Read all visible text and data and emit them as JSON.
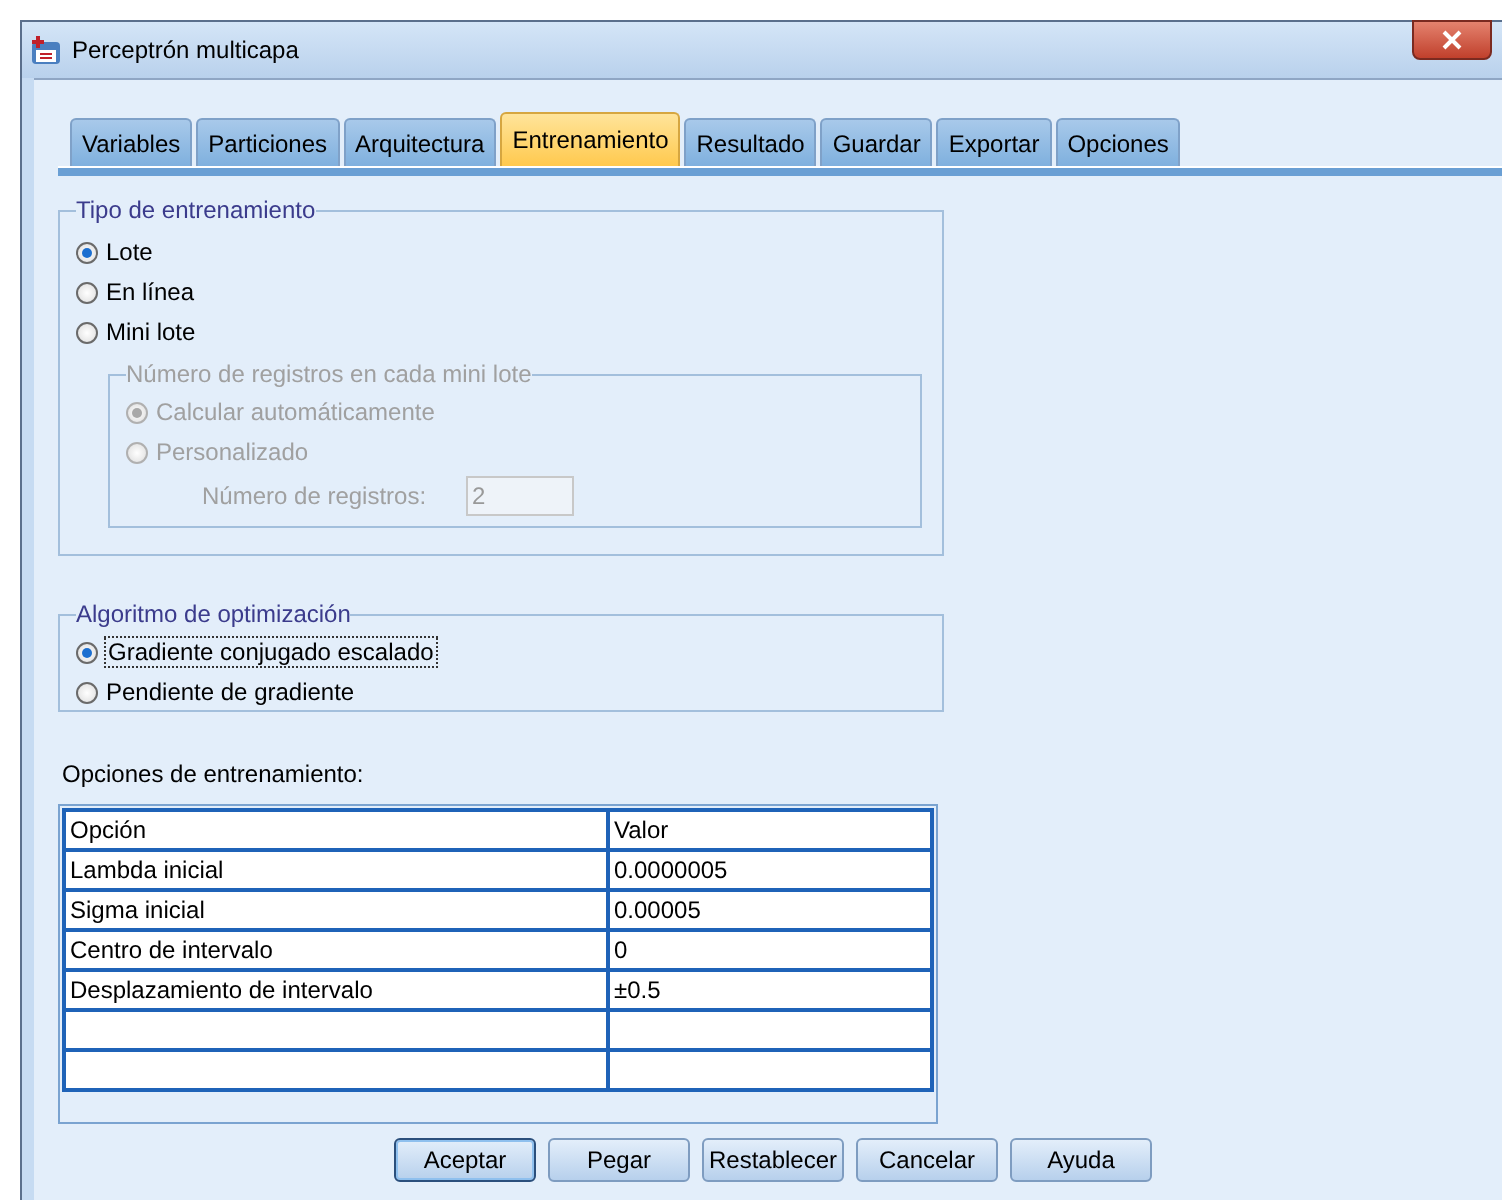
{
  "window": {
    "title": "Perceptrón multicapa"
  },
  "tabs": [
    {
      "label": "Variables",
      "selected": false
    },
    {
      "label": "Particiones",
      "selected": false
    },
    {
      "label": "Arquitectura",
      "selected": false
    },
    {
      "label": "Entrenamiento",
      "selected": true
    },
    {
      "label": "Resultado",
      "selected": false
    },
    {
      "label": "Guardar",
      "selected": false
    },
    {
      "label": "Exportar",
      "selected": false
    },
    {
      "label": "Opciones",
      "selected": false
    }
  ],
  "training_type": {
    "title": "Tipo de entrenamiento",
    "options": [
      {
        "label": "Lote",
        "selected": true
      },
      {
        "label": "En línea",
        "selected": false
      },
      {
        "label": "Mini lote",
        "selected": false
      }
    ]
  },
  "mini_batch": {
    "title": "Número de registros en cada mini lote",
    "disabled": true,
    "options": [
      {
        "label": "Calcular automáticamente",
        "selected": true
      },
      {
        "label": "Personalizado",
        "selected": false
      }
    ],
    "records_label": "Número de registros:",
    "records_value": "2"
  },
  "algorithm": {
    "title": "Algoritmo de optimización",
    "options": [
      {
        "label": "Gradiente conjugado escalado",
        "selected": true,
        "focused": true
      },
      {
        "label": "Pendiente de gradiente",
        "selected": false,
        "focused": false
      }
    ]
  },
  "options_table": {
    "label": "Opciones de entrenamiento:",
    "columns": [
      "Opción",
      "Valor"
    ],
    "rows": [
      [
        "Lambda inicial",
        "0.0000005"
      ],
      [
        "Sigma inicial",
        "0.00005"
      ],
      [
        "Centro de intervalo",
        "0"
      ],
      [
        "Desplazamiento de intervalo",
        "±0.5"
      ]
    ]
  },
  "buttons": [
    {
      "label": "Aceptar",
      "default": true
    },
    {
      "label": "Pegar",
      "default": false
    },
    {
      "label": "Restablecer",
      "default": false
    },
    {
      "label": "Cancelar",
      "default": false
    },
    {
      "label": "Ayuda",
      "default": false
    }
  ]
}
